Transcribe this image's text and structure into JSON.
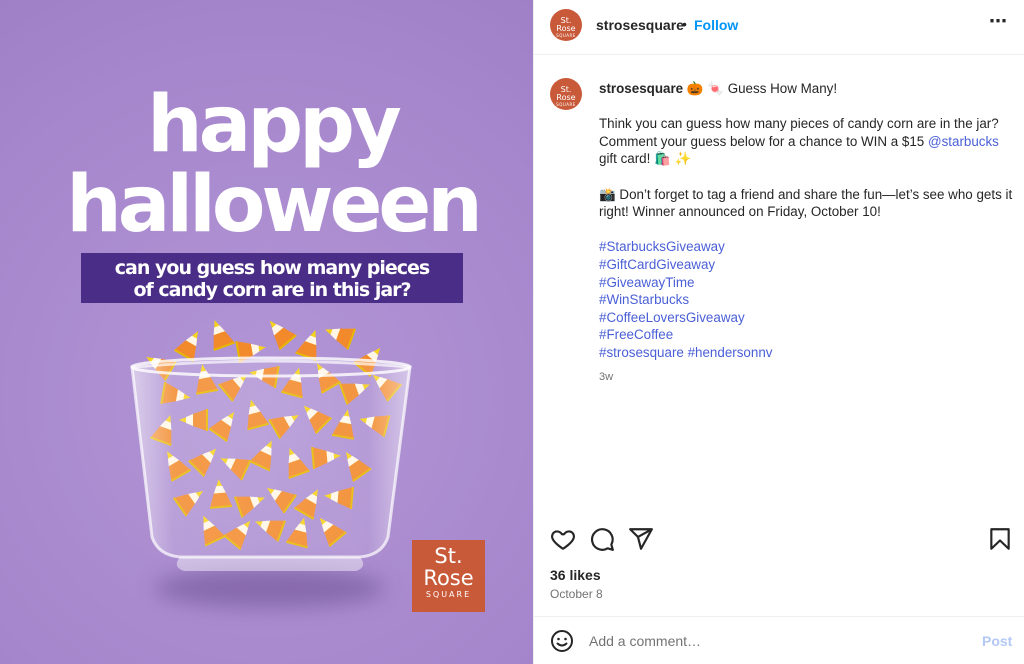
{
  "image": {
    "headline_line1": "happy",
    "headline_line2": "halloween",
    "banner_line1": "can you guess how many pieces",
    "banner_line2": "of candy corn are in this  jar?",
    "logo_st": "St.",
    "logo_rose": "Rose",
    "logo_square": "SQUARE",
    "background_color": "#a98bd0",
    "banner_color": "#4a2d86",
    "logo_color": "#c85a3a"
  },
  "header": {
    "avatar_st": "St.",
    "avatar_rose": "Rose",
    "avatar_square": "SQUARE",
    "username": "strosesquare",
    "dot": "•",
    "follow_label": "Follow",
    "more_icon": "⋯"
  },
  "caption": {
    "username": "strosesquare",
    "emoji_1": "🎃",
    "emoji_2": "🍬",
    "title": "Guess How Many!",
    "para1": "Think you can guess how many pieces of candy corn are in the jar? Comment your guess below for a chance to WIN a $15 ",
    "mention": "@starbucks",
    "para1_end": "gift card! 🛍️ ✨",
    "para2": "📸  Don’t forget to tag a friend and share the fun—let’s see who gets it right! Winner announced on Friday, October 10!",
    "hashtags": [
      "#StarbucksGiveaway",
      "#GiftCardGiveaway",
      "#GiveawayTime",
      "#WinStarbucks",
      "#CoffeeLoversGiveaway",
      "#FreeCoffee"
    ],
    "hashtag_last_1": "#strosesquare",
    "hashtag_last_2": "#hendersonnv",
    "time_ago": "3w"
  },
  "actions": {
    "like_icon": "heart-icon",
    "comment_icon": "comment-icon",
    "share_icon": "share-icon",
    "save_icon": "bookmark-icon"
  },
  "likes": "36 likes",
  "date": "October 8",
  "comment_bar": {
    "emoji_icon": "smiley-icon",
    "placeholder": "Add a comment…",
    "post_label": "Post",
    "post_color": "#b3c8f5"
  },
  "colors": {
    "link": "#0095f6",
    "hashtag": "#4a5fd6",
    "muted": "#737373"
  }
}
